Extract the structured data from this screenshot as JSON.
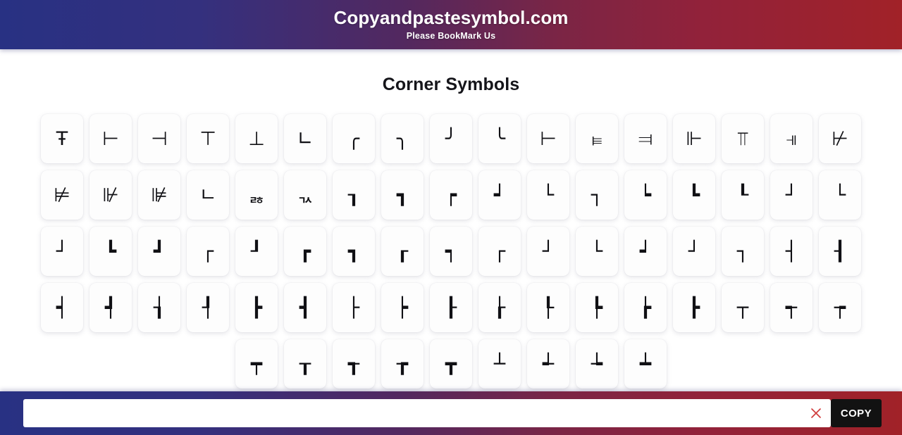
{
  "header": {
    "title": "Copyandpastesymbol.com",
    "subtitle": "Please BookMark Us",
    "gradient_start": "#283183",
    "gradient_end": "#a12228"
  },
  "main": {
    "page_title": "Corner Symbols"
  },
  "symbols": [
    "Ŧ",
    "⊢",
    "⊣",
    "⊤",
    "⊥",
    "∟",
    "╭",
    "╮",
    "╯",
    "╰",
    "⊢",
    "⫢",
    "⫤",
    "⊩",
    "⫪",
    "⫣",
    "⊬",
    "⊭",
    "⊮",
    "⊯",
    "ㄴ",
    "ᆶ",
    "ᆪ",
    "┒",
    "┓",
    "┍",
    "┙",
    "└",
    "┐",
    "┕",
    "┗",
    "┖",
    "┘",
    "└",
    "┘",
    "┗",
    "┛",
    "┌",
    "┚",
    "┏",
    "┓",
    "┎",
    "┑",
    "┌",
    "┘",
    "└",
    "┙",
    "┘",
    "┐",
    "┤",
    "┨",
    "┥",
    "┩",
    "┧",
    "┦",
    "┣",
    "┫",
    "├",
    "┝",
    "┠",
    "┟",
    "┞",
    "┡",
    "┢",
    "┣",
    "┬",
    "┭",
    "┮",
    "┯",
    "┰",
    "┱",
    "┲",
    "┳",
    "┴",
    "┵",
    "┶",
    "┷"
  ],
  "bottom_bar": {
    "input_value": "",
    "input_placeholder": "",
    "clear_icon": "close-x-icon",
    "clear_icon_color": "#d03c3c",
    "copy_label": "COPY",
    "copy_button_color": "#121212"
  }
}
